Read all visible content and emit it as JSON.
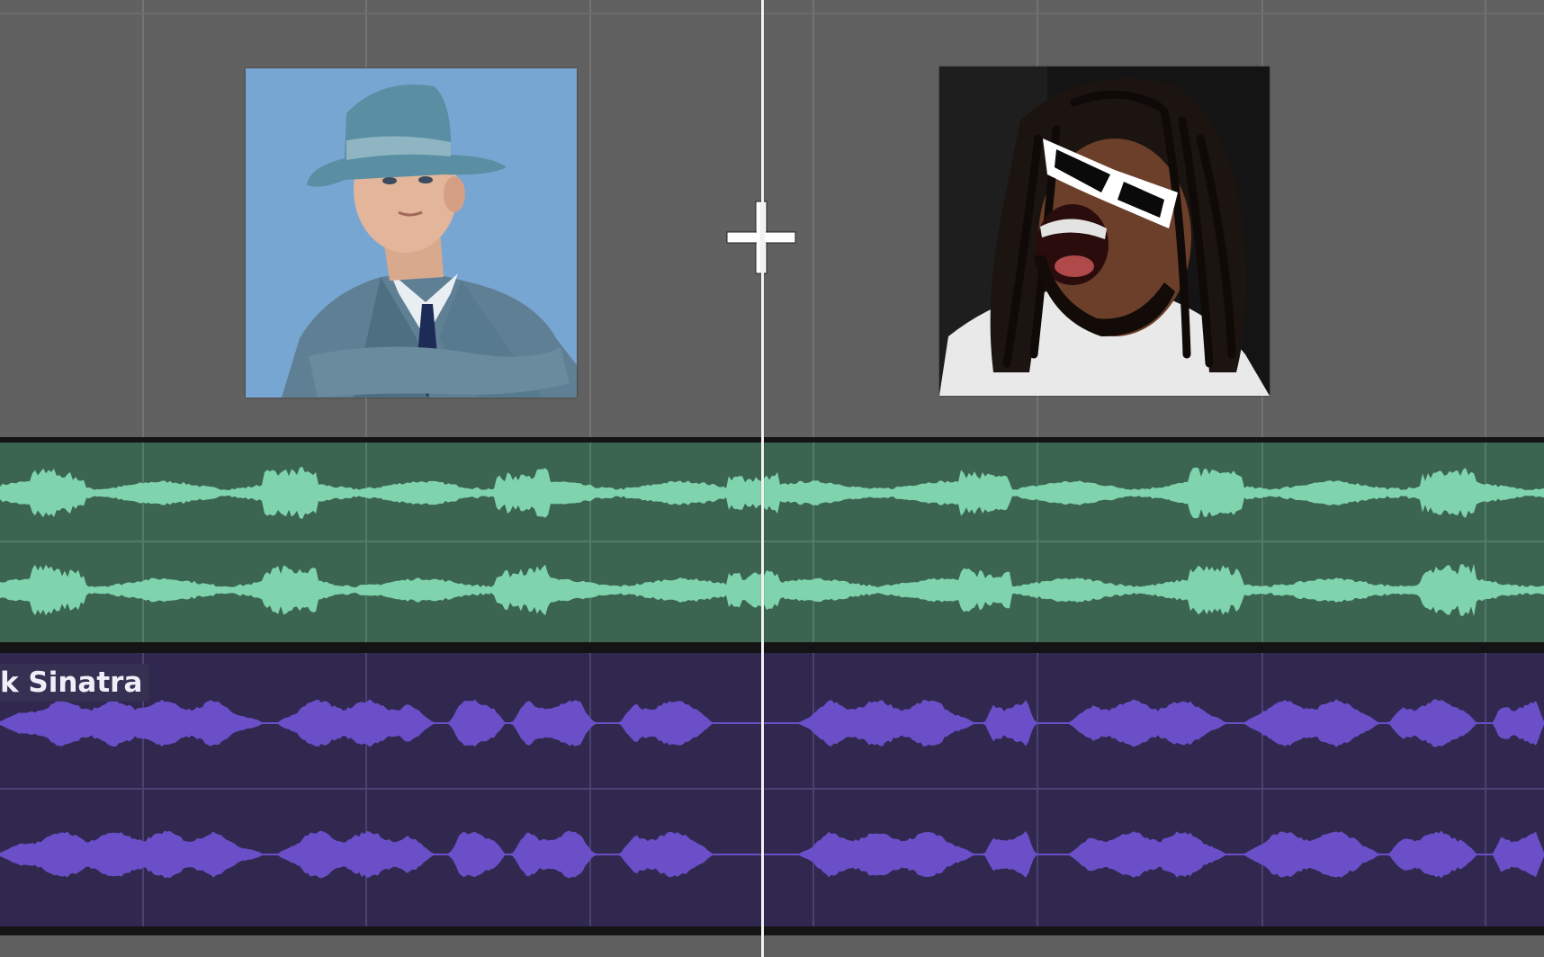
{
  "app": {
    "type": "audio-editor-timeline"
  },
  "colors": {
    "top_area": "#616161",
    "grid_line_top": "#737373",
    "track_green_bg": "#3b6451",
    "track_green_wave": "#7fd3ad",
    "track_green_grid": "#4f7b67",
    "track_purple_bg": "#30284f",
    "track_purple_wave": "#6a4fc8",
    "track_purple_grid": "#4a4170",
    "playhead": "#f2f2f2",
    "separator": "#141414"
  },
  "images": {
    "left_thumbnail": {
      "icon": "singer-portrait-fedora",
      "bg": "#78a6d2"
    },
    "right_thumbnail": {
      "icon": "rapper-portrait-white-sunglasses",
      "bg": "#1a1a1a"
    },
    "combine_symbol": {
      "icon": "plus-icon"
    }
  },
  "tracks": [
    {
      "id": "track-1",
      "color": "green",
      "channels": 2,
      "label": ""
    },
    {
      "id": "track-2",
      "color": "purple",
      "channels": 2,
      "label": "k Sinatra"
    }
  ]
}
